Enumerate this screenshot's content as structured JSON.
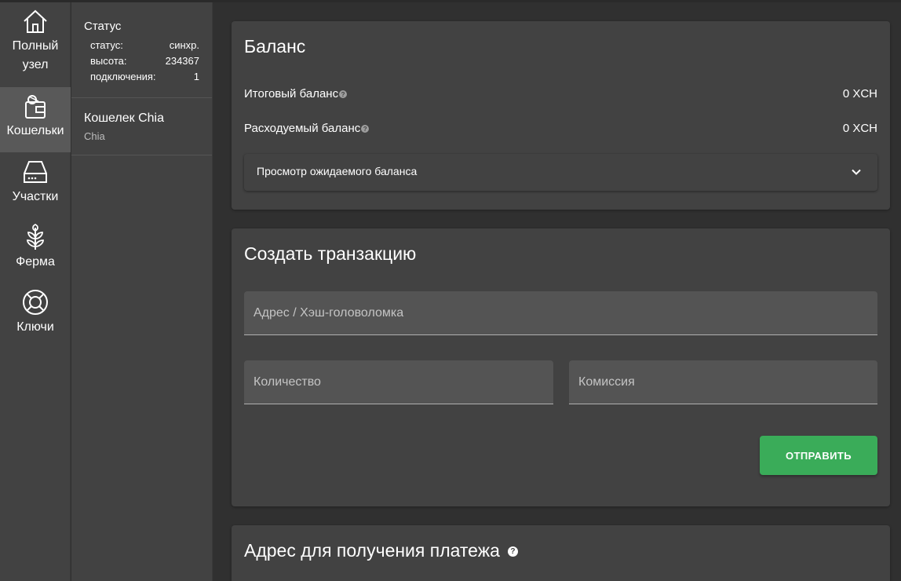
{
  "nav": {
    "items": [
      {
        "label": "Полный узел",
        "icon": "home-icon"
      },
      {
        "label": "Кошельки",
        "icon": "wallet-icon",
        "active": true
      },
      {
        "label": "Участки",
        "icon": "hard-drive-icon"
      },
      {
        "label": "Ферма",
        "icon": "sprout-icon"
      },
      {
        "label": "Ключи",
        "icon": "lifebuoy-icon"
      }
    ]
  },
  "status": {
    "title": "Статус",
    "rows": [
      {
        "label": "статус:",
        "value": "синхр."
      },
      {
        "label": "высота:",
        "value": "234367"
      },
      {
        "label": "подключения:",
        "value": "1"
      }
    ]
  },
  "wallet": {
    "name": "Кошелек Chia",
    "sub": "Chia"
  },
  "balance": {
    "title": "Баланс",
    "total_label": "Итоговый баланс",
    "total_value": "0 XCH",
    "spendable_label": "Расходуемый баланс",
    "spendable_value": "0 XCH",
    "pending_label": "Просмотр ожидаемого баланса"
  },
  "transaction": {
    "title": "Создать транзакцию",
    "address_placeholder": "Адрес / Хэш-головоломка",
    "amount_placeholder": "Количество",
    "fee_placeholder": "Комиссия",
    "send_label": "ОТПРАВИТЬ"
  },
  "receive": {
    "title": "Адрес для получения платежа"
  },
  "colors": {
    "accent": "#3aac59",
    "background": "#303030",
    "card": "#424242"
  }
}
